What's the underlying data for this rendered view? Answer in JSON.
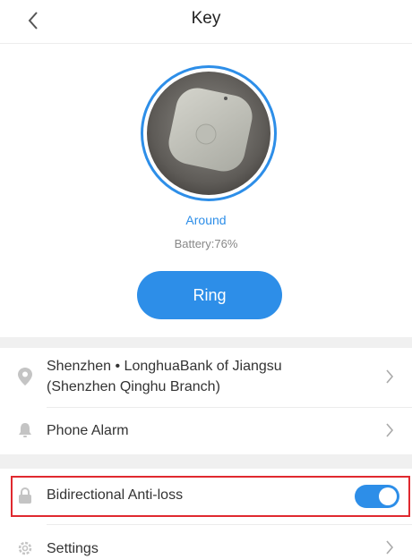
{
  "header": {
    "title": "Key",
    "back_icon": "chevron-left-icon"
  },
  "device": {
    "status": "Around",
    "battery": "Battery:76%",
    "ring_label": "Ring"
  },
  "list": {
    "location": {
      "line1": "Shenzhen • LonghuaBank of Jiangsu",
      "line2": "(Shenzhen Qinghu Branch)",
      "icon": "location-pin-icon"
    },
    "phone_alarm": {
      "label": "Phone Alarm",
      "icon": "bell-icon"
    },
    "anti_loss": {
      "label": "Bidirectional Anti-loss",
      "icon": "lock-icon",
      "enabled": true
    },
    "settings": {
      "label": "Settings",
      "icon": "gear-icon"
    }
  },
  "colors": {
    "accent": "#2d8ee8",
    "highlight": "#e0292f",
    "icon_gray": "#c4c4c4"
  }
}
